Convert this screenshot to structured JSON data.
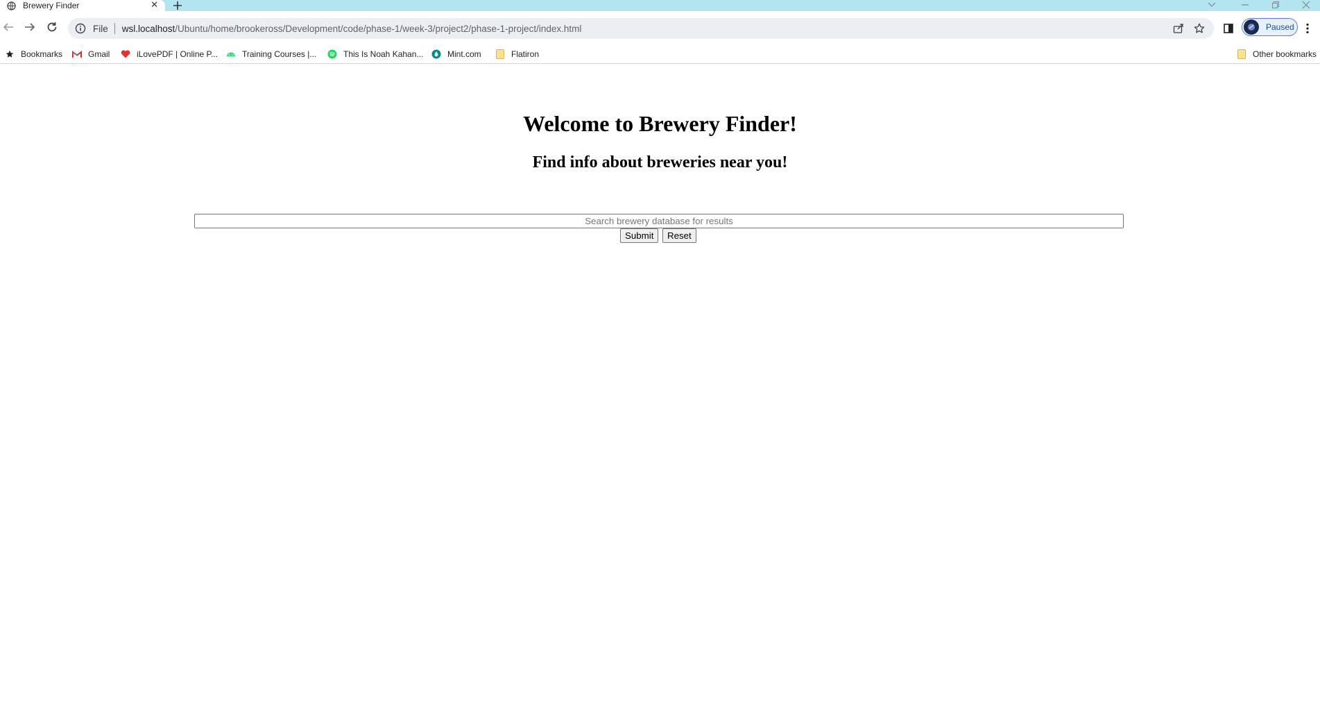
{
  "browser": {
    "tab": {
      "title": "Brewery Finder"
    },
    "address": {
      "scheme_label": "File",
      "host": "wsl.localhost",
      "path": "/Ubuntu/home/brookeross/Development/code/phase-1/week-3/project2/phase-1-project/index.html"
    },
    "profile": {
      "label": "Paused"
    },
    "bookmarks": [
      {
        "label": "Bookmarks",
        "icon": "star-icon"
      },
      {
        "label": "Gmail",
        "icon": "gmail-icon"
      },
      {
        "label": "iLovePDF | Online P...",
        "icon": "heart-icon"
      },
      {
        "label": "Training Courses |...",
        "icon": "android-icon"
      },
      {
        "label": "This Is Noah Kahan...",
        "icon": "spotify-icon"
      },
      {
        "label": "Mint.com",
        "icon": "mint-icon"
      },
      {
        "label": "Flatiron",
        "icon": "folder-icon"
      }
    ],
    "other_bookmarks": {
      "label": "Other bookmarks",
      "icon": "folder-icon"
    },
    "colors": {
      "tabstrip": "#b3e5f0",
      "omnibox": "#ebeff3",
      "profile_accent": "#174ea6"
    }
  },
  "page": {
    "heading": "Welcome to Brewery Finder!",
    "subheading": "Find info about breweries near you!",
    "search": {
      "placeholder": "Search brewery database for results",
      "value": ""
    },
    "buttons": {
      "submit": "Submit",
      "reset": "Reset"
    }
  }
}
